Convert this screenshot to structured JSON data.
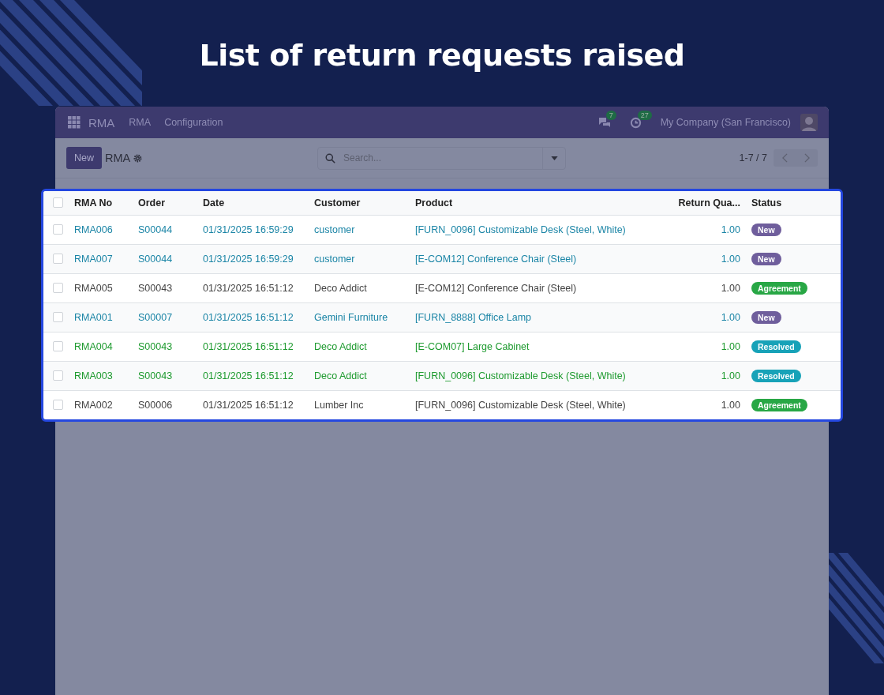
{
  "heading": "List of return requests raised",
  "navbar": {
    "app_name": "RMA",
    "menu": [
      "RMA",
      "Configuration"
    ],
    "messages_badge": "7",
    "activities_badge": "27",
    "company": "My Company (San Francisco)"
  },
  "control_panel": {
    "new_button": "New",
    "breadcrumb": "RMA",
    "search": {
      "placeholder": "Search..."
    },
    "pager": "1-7 / 7"
  },
  "table": {
    "select_all_checked": false,
    "columns": [
      "RMA No",
      "Order",
      "Date",
      "Customer",
      "Product",
      "Return Qua...",
      "Status"
    ],
    "rows": [
      {
        "checked": false,
        "kind": "link",
        "cells": [
          "RMA006",
          "S00044",
          "01/31/2025 16:59:29",
          "customer",
          "[FURN_0096] Customizable Desk (Steel, White)",
          "1.00"
        ],
        "status": {
          "label": "New",
          "color": "#6f5e9c"
        }
      },
      {
        "checked": false,
        "kind": "link",
        "cells": [
          "RMA007",
          "S00044",
          "01/31/2025 16:59:29",
          "customer",
          "[E-COM12] Conference Chair (Steel)",
          "1.00"
        ],
        "status": {
          "label": "New",
          "color": "#6f5e9c"
        }
      },
      {
        "checked": false,
        "kind": "plain",
        "cells": [
          "RMA005",
          "S00043",
          "01/31/2025 16:51:12",
          "Deco Addict",
          "[E-COM12] Conference Chair (Steel)",
          "1.00"
        ],
        "status": {
          "label": "Agreement",
          "color": "#28a745"
        }
      },
      {
        "checked": false,
        "kind": "link",
        "cells": [
          "RMA001",
          "S00007",
          "01/31/2025 16:51:12",
          "Gemini Furniture",
          "[FURN_8888] Office Lamp",
          "1.00"
        ],
        "status": {
          "label": "New",
          "color": "#6f5e9c"
        }
      },
      {
        "checked": false,
        "kind": "success",
        "cells": [
          "RMA004",
          "S00043",
          "01/31/2025 16:51:12",
          "Deco Addict",
          "[E-COM07] Large Cabinet",
          "1.00"
        ],
        "status": {
          "label": "Resolved",
          "color": "#17a2b8"
        }
      },
      {
        "checked": false,
        "kind": "success",
        "cells": [
          "RMA003",
          "S00043",
          "01/31/2025 16:51:12",
          "Deco Addict",
          "[FURN_0096] Customizable Desk (Steel, White)",
          "1.00"
        ],
        "status": {
          "label": "Resolved",
          "color": "#17a2b8"
        }
      },
      {
        "checked": false,
        "kind": "plain",
        "cells": [
          "RMA002",
          "S00006",
          "01/31/2025 16:51:12",
          "Lumber Inc",
          "[FURN_0096] Customizable Desk (Steel, White)",
          "1.00"
        ],
        "status": {
          "label": "Agreement",
          "color": "#28a745"
        }
      }
    ]
  }
}
